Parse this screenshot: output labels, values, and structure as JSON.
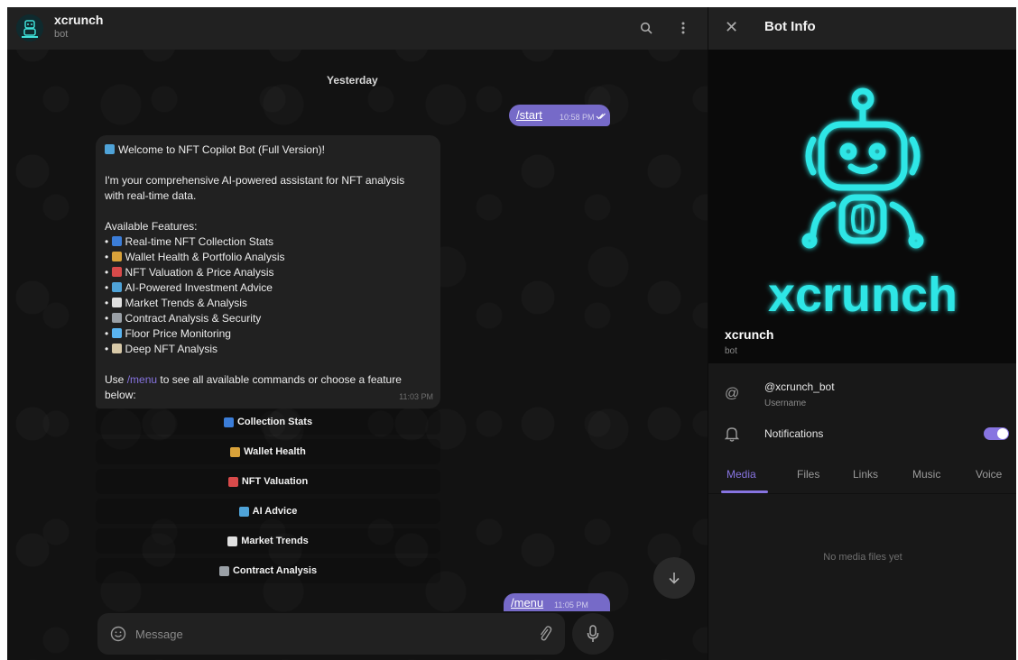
{
  "chat": {
    "title": "xcrunch",
    "subtitle": "bot",
    "date_separator": "Yesterday",
    "out_messages": [
      {
        "text": "/start",
        "time": "10:58 PM"
      },
      {
        "text": "/menu",
        "time": "11:05 PM"
      }
    ],
    "welcome": {
      "lines": [
        "Welcome to NFT Copilot Bot (Full Version)!",
        "",
        "I'm your comprehensive AI-powered assistant for NFT analysis",
        "with real-time data.",
        "",
        "Available Features:",
        "Real-time NFT Collection Stats",
        "Wallet Health & Portfolio Analysis",
        "NFT Valuation & Price Analysis",
        "AI-Powered Investment Advice",
        "Market Trends & Analysis",
        "Contract Analysis & Security",
        "Floor Price Monitoring",
        "Deep NFT Analysis",
        "",
        "Use",
        "/menu",
        "to see all available commands or choose a feature",
        "below:"
      ],
      "time": "11:03 PM"
    },
    "keyboard_buttons": [
      "Collection Stats",
      "Wallet Health",
      "NFT Valuation",
      "AI Advice",
      "Market Trends",
      "Contract Analysis"
    ],
    "composer_placeholder": "Message"
  },
  "info": {
    "title": "Bot Info",
    "hero_logo_text": "xcrunch",
    "name": "xcrunch",
    "name_sub": "bot",
    "username": "@xcrunch_bot",
    "username_label": "Username",
    "notifications_label": "Notifications",
    "notifications_on": true,
    "tabs": [
      "Media",
      "Files",
      "Links",
      "Music",
      "Voice"
    ],
    "active_tab": "Media",
    "empty_text": "No media files yet"
  },
  "colors": {
    "accent": "#8774e1",
    "outgoing_bubble": "#766ac8",
    "logo_cyan": "#2ee6e6"
  }
}
